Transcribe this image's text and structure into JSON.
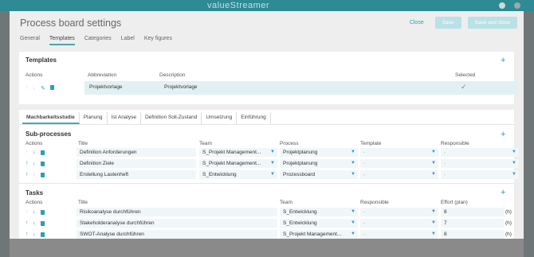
{
  "app": {
    "brand": "valueStreamer"
  },
  "modal": {
    "title": "Process board settings",
    "close_label": "Close",
    "save_label": "Save",
    "save_close_label": "Save and close",
    "tabs": [
      "General",
      "Templates",
      "Categories",
      "Label",
      "Key figures"
    ],
    "active_tab": "Templates"
  },
  "templates": {
    "title": "Templates",
    "columns": {
      "actions": "Actions",
      "abbreviation": "Abbreviation",
      "description": "Description",
      "selected": "Selected"
    },
    "rows": [
      {
        "abbreviation": "Projektvorlage",
        "description": "Projektvorlage",
        "selected": true
      }
    ]
  },
  "phase_tabs": [
    "Machbarkeitsstudie",
    "Planung",
    "Ist Analyse",
    "Definition Soll-Zustand",
    "Umsetzung",
    "Einführung"
  ],
  "subprocesses": {
    "title": "Sub-processes",
    "columns": {
      "actions": "Actions",
      "title": "Title",
      "team": "Team",
      "process": "Process",
      "template": "Template",
      "responsible": "Responsible"
    },
    "rows": [
      {
        "title": "Definition Anforderungen",
        "team": "S_Projekt Management...",
        "process": "Projektplanung",
        "template": "-",
        "responsible": "-"
      },
      {
        "title": "Definition Ziele",
        "team": "S_Projekt Management...",
        "process": "Projektplanung",
        "template": "-",
        "responsible": "-"
      },
      {
        "title": "Erstellung Lastenheft",
        "team": "S_Entwicklung",
        "process": "Prozessboard",
        "template": "-",
        "responsible": "-"
      }
    ]
  },
  "tasks": {
    "title": "Tasks",
    "columns": {
      "actions": "Actions",
      "title": "Title",
      "team": "Team",
      "responsible": "Responsible",
      "effort": "Effort (plan)"
    },
    "unit": "(h)",
    "rows": [
      {
        "title": "Risikoanalyse durchführen",
        "team": "S_Entwicklung",
        "responsible": "-",
        "effort": "8"
      },
      {
        "title": "Stakeholderanalyse durchführen",
        "team": "S_Entwicklung",
        "responsible": "-",
        "effort": "7"
      },
      {
        "title": "SWOT-Analyse durchführen",
        "team": "S_Projekt Management...",
        "responsible": "-",
        "effort": "8"
      }
    ]
  }
}
